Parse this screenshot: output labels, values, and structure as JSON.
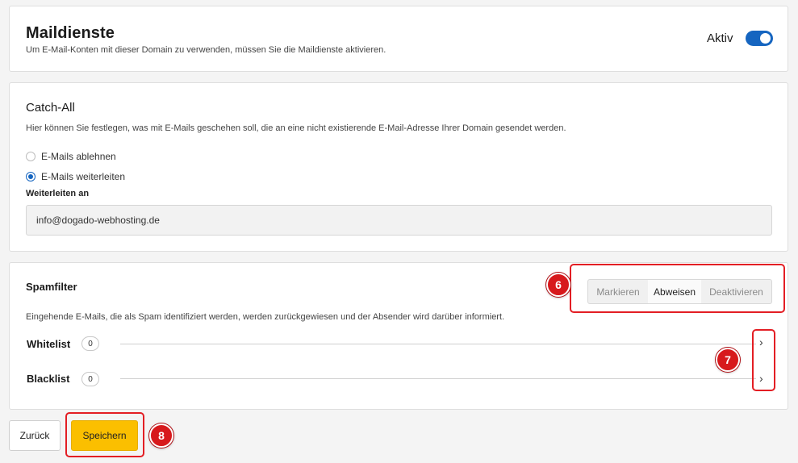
{
  "mail": {
    "title": "Maildienste",
    "description": "Um E-Mail-Konten mit dieser Domain zu verwenden, müssen Sie die Maildienste aktivieren.",
    "toggle_label": "Aktiv",
    "toggle_on": true
  },
  "catch_all": {
    "title": "Catch-All",
    "description": "Hier können Sie festlegen, was mit E-Mails geschehen soll, die an eine nicht existierende E-Mail-Adresse Ihrer Domain gesendet werden.",
    "options": [
      {
        "label": "E-Mails ablehnen",
        "selected": false
      },
      {
        "label": "E-Mails weiterleiten",
        "selected": true
      }
    ],
    "forward_label": "Weiterleiten an",
    "forward_value": "info@dogado-webhosting.de"
  },
  "spam": {
    "title": "Spamfilter",
    "modes": [
      "Markieren",
      "Abweisen",
      "Deaktivieren"
    ],
    "active_mode": "Abweisen",
    "description": "Eingehende E-Mails, die als Spam identifiziert werden, werden zurückgewiesen und der Absender wird darüber informiert.",
    "lists": [
      {
        "label": "Whitelist",
        "count": "0"
      },
      {
        "label": "Blacklist",
        "count": "0"
      }
    ]
  },
  "actions": {
    "back_label": "Zurück",
    "save_label": "Speichern"
  },
  "markers": [
    "6",
    "7",
    "8"
  ],
  "colors": {
    "accent": "#1565c0",
    "save": "#fbbf00",
    "highlight": "#e31e24"
  }
}
